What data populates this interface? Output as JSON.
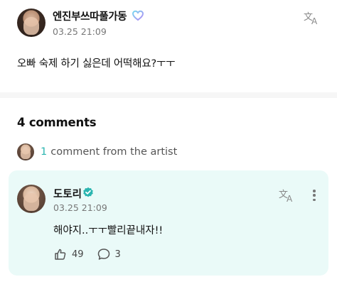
{
  "post": {
    "username": "엔진부쓰따풀가동",
    "timestamp": "03.25 21:09",
    "text": "오빠 숙제 하기 싫은데 어떡해요?ㅜㅜ",
    "badge_icon": "heart-badge-icon",
    "translate_icon": "translate-icon"
  },
  "comments": {
    "title": "4 comments",
    "artist_summary": {
      "count": "1",
      "label": "comment from the artist"
    }
  },
  "artist_comment": {
    "username": "도토리",
    "verified_icon": "verified-icon",
    "timestamp": "03.25 21:09",
    "text": "해야지..ㅜㅜ빨리끝내자!!",
    "likes": "49",
    "replies": "3"
  },
  "colors": {
    "accent_teal": "#2bb5b0",
    "card_background": "#eafaf8",
    "heart_gradient_start": "#7ad7f0",
    "heart_gradient_end": "#b48af5"
  }
}
